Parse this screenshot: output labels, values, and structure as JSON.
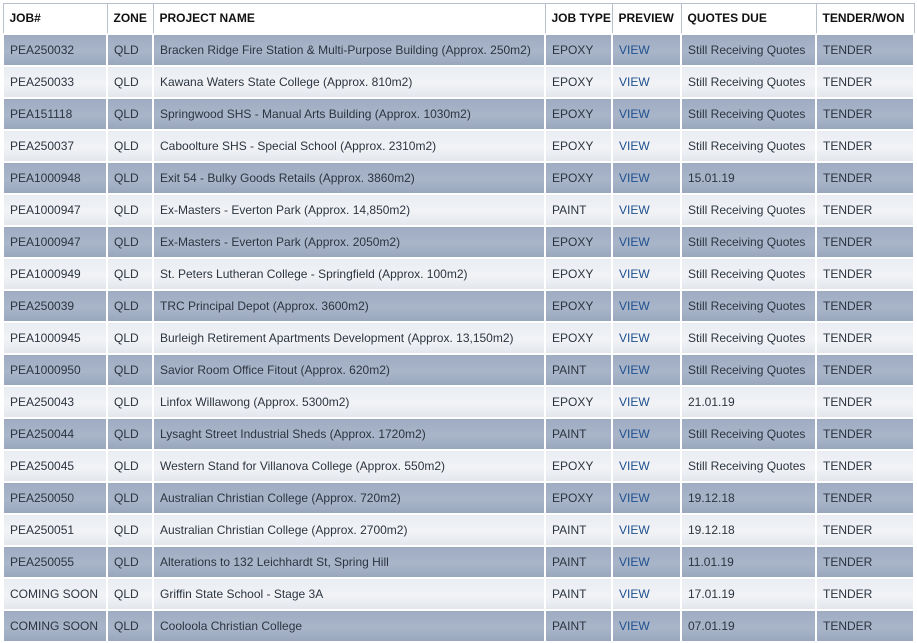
{
  "columns": [
    "JOB#",
    "ZONE",
    "PROJECT NAME",
    "JOB TYPE",
    "PREVIEW",
    "QUOTES DUE",
    "TENDER/WON"
  ],
  "rows": [
    {
      "job": "PEA250032",
      "zone": "QLD",
      "project": "Bracken Ridge Fire Station & Multi-Purpose Building (Approx. 250m2)",
      "type": "EPOXY",
      "preview": "VIEW",
      "due": "Still Receiving Quotes",
      "status": "TENDER"
    },
    {
      "job": "PEA250033",
      "zone": "QLD",
      "project": "Kawana Waters State College (Approx. 810m2)",
      "type": "EPOXY",
      "preview": "VIEW",
      "due": "Still Receiving Quotes",
      "status": "TENDER"
    },
    {
      "job": "PEA151118",
      "zone": "QLD",
      "project": "Springwood SHS - Manual Arts Building (Approx. 1030m2)",
      "type": "EPOXY",
      "preview": "VIEW",
      "due": "Still Receiving Quotes",
      "status": "TENDER"
    },
    {
      "job": "PEA250037",
      "zone": "QLD",
      "project": "Caboolture SHS - Special School (Approx. 2310m2)",
      "type": "EPOXY",
      "preview": "VIEW",
      "due": "Still Receiving Quotes",
      "status": "TENDER"
    },
    {
      "job": "PEA1000948",
      "zone": "QLD",
      "project": "Exit 54 - Bulky Goods Retails (Approx. 3860m2)",
      "type": "EPOXY",
      "preview": "VIEW",
      "due": "15.01.19",
      "status": "TENDER"
    },
    {
      "job": "PEA1000947",
      "zone": "QLD",
      "project": "Ex-Masters - Everton Park (Approx. 14,850m2)",
      "type": "PAINT",
      "preview": "VIEW",
      "due": "Still Receiving Quotes",
      "status": "TENDER"
    },
    {
      "job": "PEA1000947",
      "zone": "QLD",
      "project": "Ex-Masters - Everton Park (Approx. 2050m2)",
      "type": "EPOXY",
      "preview": "VIEW",
      "due": "Still Receiving Quotes",
      "status": "TENDER"
    },
    {
      "job": "PEA1000949",
      "zone": "QLD",
      "project": "St. Peters Lutheran College - Springfield (Approx. 100m2)",
      "type": "EPOXY",
      "preview": "VIEW",
      "due": "Still Receiving Quotes",
      "status": "TENDER"
    },
    {
      "job": "PEA250039",
      "zone": "QLD",
      "project": "TRC Principal Depot (Approx. 3600m2)",
      "type": "EPOXY",
      "preview": "VIEW",
      "due": "Still Receiving Quotes",
      "status": "TENDER"
    },
    {
      "job": "PEA1000945",
      "zone": "QLD",
      "project": "Burleigh Retirement Apartments Development (Approx. 13,150m2)",
      "type": "EPOXY",
      "preview": "VIEW",
      "due": "Still Receiving Quotes",
      "status": "TENDER"
    },
    {
      "job": "PEA1000950",
      "zone": "QLD",
      "project": "Savior Room Office Fitout (Approx. 620m2)",
      "type": "PAINT",
      "preview": "VIEW",
      "due": "Still Receiving Quotes",
      "status": "TENDER"
    },
    {
      "job": "PEA250043",
      "zone": "QLD",
      "project": "Linfox Willawong (Approx. 5300m2)",
      "type": "EPOXY",
      "preview": "VIEW",
      "due": "21.01.19",
      "status": "TENDER"
    },
    {
      "job": "PEA250044",
      "zone": "QLD",
      "project": "Lysaght Street Industrial Sheds (Approx. 1720m2)",
      "type": "PAINT",
      "preview": "VIEW",
      "due": "Still Receiving Quotes",
      "status": "TENDER"
    },
    {
      "job": "PEA250045",
      "zone": "QLD",
      "project": "Western Stand for Villanova College (Approx. 550m2)",
      "type": "EPOXY",
      "preview": "VIEW",
      "due": "Still Receiving Quotes",
      "status": "TENDER"
    },
    {
      "job": "PEA250050",
      "zone": "QLD",
      "project": "Australian Christian College (Approx. 720m2)",
      "type": "EPOXY",
      "preview": "VIEW",
      "due": "19.12.18",
      "status": "TENDER"
    },
    {
      "job": "PEA250051",
      "zone": "QLD",
      "project": "Australian Christian College (Approx. 2700m2)",
      "type": "PAINT",
      "preview": "VIEW",
      "due": "19.12.18",
      "status": "TENDER"
    },
    {
      "job": "PEA250055",
      "zone": "QLD",
      "project": "Alterations to 132 Leichhardt St, Spring Hill",
      "type": "PAINT",
      "preview": "VIEW",
      "due": "11.01.19",
      "status": "TENDER"
    },
    {
      "job": "COMING SOON",
      "zone": "QLD",
      "project": "Griffin State School - Stage 3A",
      "type": "PAINT",
      "preview": "VIEW",
      "due": "17.01.19",
      "status": "TENDER"
    },
    {
      "job": "COMING SOON",
      "zone": "QLD",
      "project": "Cooloola Christian College",
      "type": "PAINT",
      "preview": "VIEW",
      "due": "07.01.19",
      "status": "TENDER"
    }
  ],
  "colors": {
    "row_dark": "#a3b0c5",
    "row_light": "#edf0f4",
    "link": "#1f4f8e",
    "text": "#2c3440"
  }
}
